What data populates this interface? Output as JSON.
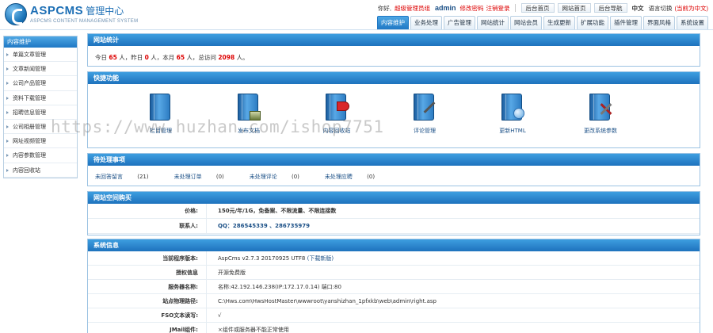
{
  "logo": {
    "brand": "ASPCMS",
    "suffix": "管理中心",
    "subtitle": "ASPCMS CONTENT MANAGEMENT SYSTEM"
  },
  "topbar": {
    "greeting": "你好,",
    "role": "超级管理员组",
    "username": "admin",
    "change_password": "修改密码",
    "logout": "注销登录",
    "buttons": [
      "后台首页",
      "网站首页",
      "后台导航"
    ],
    "lang_label": "中文",
    "lang_switch": "语言切换",
    "lang_current": "(当前为中文)"
  },
  "nav": {
    "tabs": [
      "内容维护",
      "业务处理",
      "广告管理",
      "网站统计",
      "网站会员",
      "生成更新",
      "扩展功能",
      "插件管理",
      "界面风格",
      "系统设置"
    ]
  },
  "sidebar": {
    "title": "内容维护",
    "items": [
      "单篇文章管理",
      "文章新闻管理",
      "公司产品管理",
      "资料下载管理",
      "招聘信息管理",
      "公司相册管理",
      "网址视频管理",
      "内容参数管理",
      "内容回收站"
    ]
  },
  "stats": {
    "title": "网站统计",
    "today_label": "今日",
    "today": "65",
    "yesterday_label": "人，昨日",
    "yesterday": "0",
    "month_label": "人，本月",
    "month": "65",
    "total_label": "人，总访问",
    "total": "2098",
    "unit_end": "人。"
  },
  "quick": {
    "title": "快捷功能",
    "items": [
      {
        "label": "栏目管理",
        "icon": "folder-book-icon"
      },
      {
        "label": "发布文档",
        "icon": "publish-document-icon"
      },
      {
        "label": "内容回收站",
        "icon": "recycle-bin-icon"
      },
      {
        "label": "评论管理",
        "icon": "comment-manage-icon"
      },
      {
        "label": "更新HTML",
        "icon": "update-html-icon"
      },
      {
        "label": "更改系统参数",
        "icon": "system-settings-icon"
      }
    ]
  },
  "todo": {
    "title": "待处理事项",
    "items": [
      {
        "label": "未回答留言",
        "count": "(21)"
      },
      {
        "label": "未处理订单",
        "count": "(0)"
      },
      {
        "label": "未处理评论",
        "count": "(0)"
      },
      {
        "label": "未处理应聘",
        "count": "(0)"
      }
    ]
  },
  "buy": {
    "title": "网站空间购买",
    "rows": [
      {
        "key": "价格:",
        "value": "150元/年/1G，免备案、不限流量、不限连接数"
      },
      {
        "key": "联系人:",
        "value": "QQ：286545339 、286735979"
      }
    ]
  },
  "sys": {
    "title": "系统信息",
    "rows": [
      {
        "key": "当前程序版本:",
        "value": "AspCms v2.7.3 20170925 UTF8",
        "extra": "(下载新版)"
      },
      {
        "key": "授权信息",
        "value": "开源免费版"
      },
      {
        "key": "服务器名称:",
        "value": "名称:42.192.146.238(IP:172.17.0.14) 端口:80"
      },
      {
        "key": "站点物理路径:",
        "value": "C:\\Hws.com\\HwsHostMaster\\wwwroot\\yanshizhan_1pfxkb\\web\\admin\\right.asp"
      },
      {
        "key": "FSO文本读写:",
        "value": "√"
      },
      {
        "key": "JMail组件:",
        "value": "×组件或服务器不能正常使用"
      }
    ]
  },
  "watermark": "https://www.huzhan.com/ishop7751"
}
